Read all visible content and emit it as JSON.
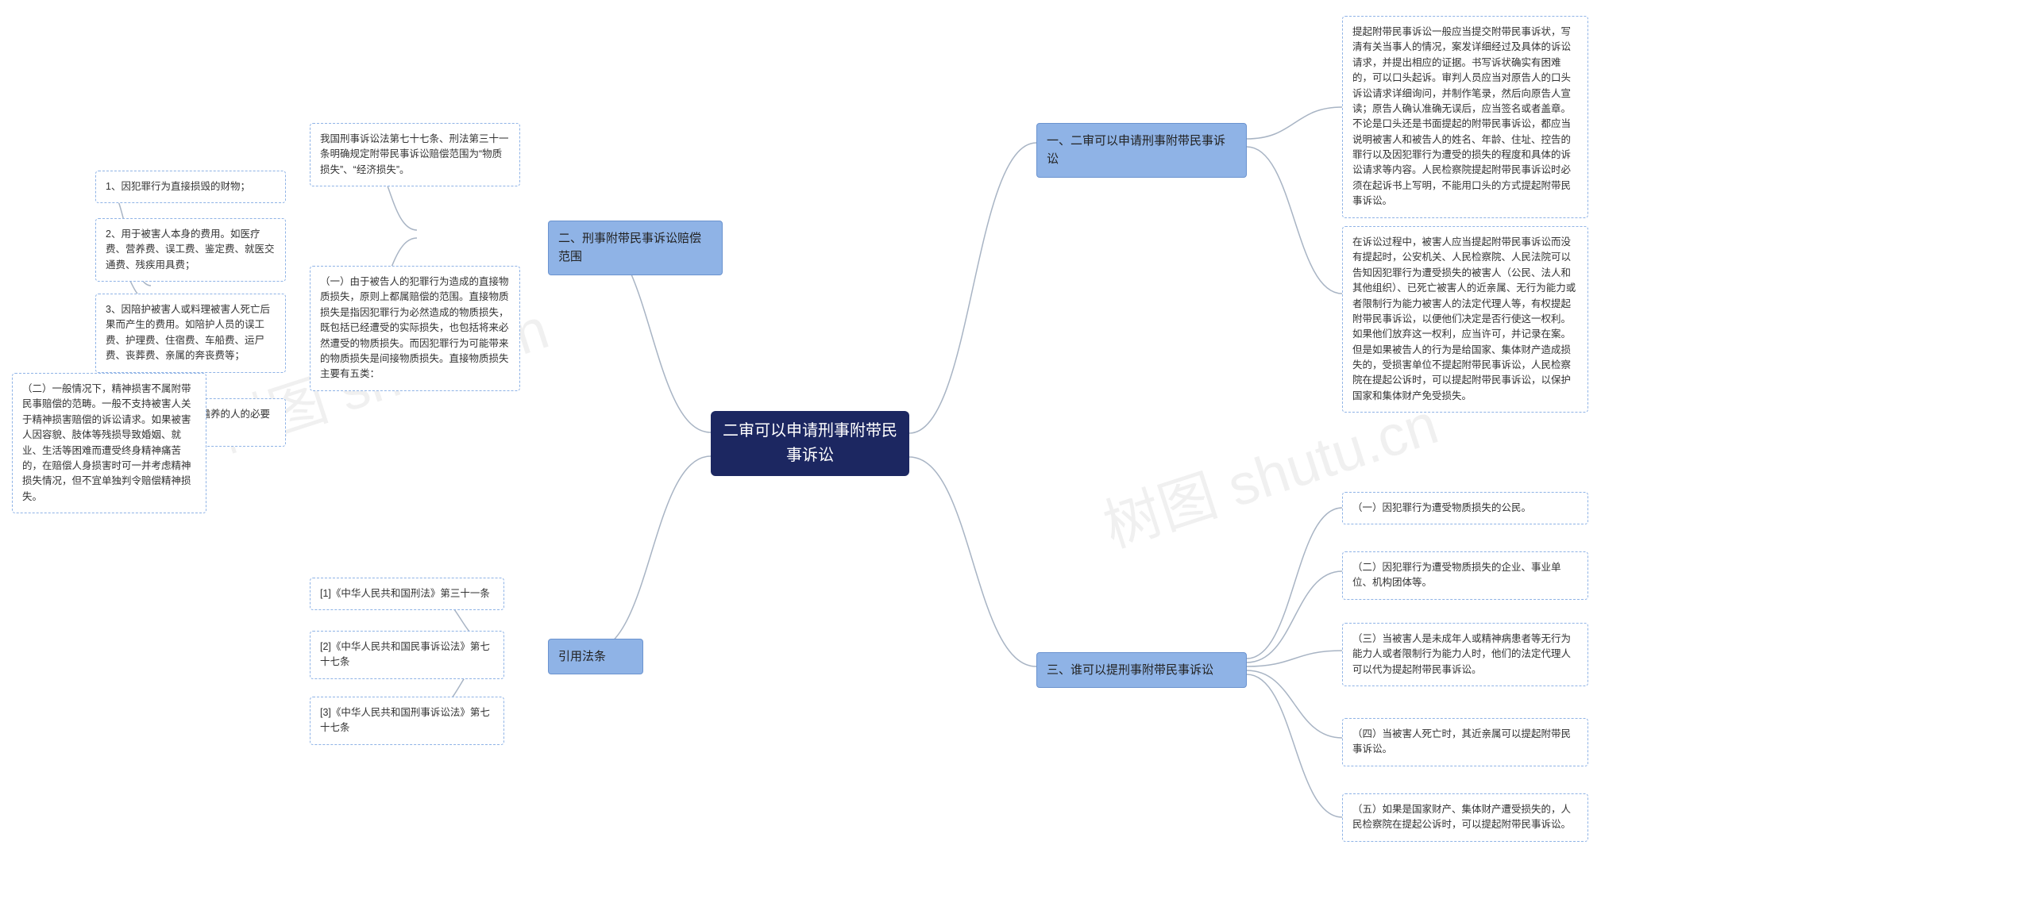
{
  "watermark": "树图 shutu.cn",
  "center": {
    "title": "二审可以申请刑事附带民事诉讼"
  },
  "right": {
    "b1": {
      "title": "一、二审可以申请刑事附带民事诉讼",
      "leaf1": "提起附带民事诉讼一般应当提交附带民事诉状，写清有关当事人的情况，案发详细经过及具体的诉讼请求，并提出相应的证据。书写诉状确实有困难的，可以口头起诉。审判人员应当对原告人的口头诉讼请求详细询问，并制作笔录，然后向原告人宣读；原告人确认准确无误后，应当签名或者盖章。不论是口头还是书面提起的附带民事诉讼，都应当说明被害人和被告人的姓名、年龄、住址、控告的罪行以及因犯罪行为遭受的损失的程度和具体的诉讼请求等内容。人民检察院提起附带民事诉讼时必须在起诉书上写明，不能用口头的方式提起附带民事诉讼。",
      "leaf2": "在诉讼过程中，被害人应当提起附带民事诉讼而没有提起时，公安机关、人民检察院、人民法院可以告知因犯罪行为遭受损失的被害人（公民、法人和其他组织）、已死亡被害人的近亲属、无行为能力或者限制行为能力被害人的法定代理人等，有权提起附带民事诉讼，以便他们决定是否行使这一权利。如果他们放弃这一权利，应当许可，并记录在案。但是如果被告人的行为是给国家、集体财产造成损失的，受损害单位不提起附带民事诉讼，人民检察院在提起公诉时，可以提起附带民事诉讼，以保护国家和集体财产免受损失。"
    },
    "b3": {
      "title": "三、谁可以提刑事附带民事诉讼",
      "leaf1": "（一）因犯罪行为遭受物质损失的公民。",
      "leaf2": "（二）因犯罪行为遭受物质损失的企业、事业单位、机构团体等。",
      "leaf3": "（三）当被害人是未成年人或精神病患者等无行为能力人或者限制行为能力人时，他们的法定代理人可以代为提起附带民事诉讼。",
      "leaf4": "（四）当被害人死亡时，其近亲属可以提起附带民事诉讼。",
      "leaf5": "（五）如果是国家财产、集体财产遭受损失的，人民检察院在提起公诉时，可以提起附带民事诉讼。"
    }
  },
  "left": {
    "b2": {
      "title": "二、刑事附带民事诉讼赔偿范围",
      "intro": "我国刑事诉讼法第七十七条、刑法第三十一条明确规定附带民事诉讼赔偿范围为“物质损失”、“经济损失”。",
      "subA": "（一）由于被告人的犯罪行为造成的直接物质损失，原则上都属赔偿的范围。直接物质损失是指因犯罪行为必然造成的物质损失，既包括已经遭受的实际损失，也包括将来必然遭受的物质损失。而因犯罪行为可能带来的物质损失是间接物质损失。直接物质损失主要有五类：",
      "subA_items": {
        "i1": "1、因犯罪行为直接损毁的财物；",
        "i2": "2、用于被害人本身的费用。如医疗费、营养费、误工费、鉴定费、就医交通费、残疾用具费；",
        "i3": "3、因陪护被害人或料理被害人死亡后果而产生的费用。如陪护人员的误工费、护理费、住宿费、车船费、运尸费、丧葬费、亲属的奔丧费等；",
        "i4": "4、原由被害人抚养和赡养的人的必要生活补助。"
      },
      "subB": "（二）一般情况下，精神损害不属附带民事赔偿的范畴。一般不支持被害人关于精神损害赔偿的诉讼请求。如果被害人因容貌、肢体等残损导致婚姻、就业、生活等困难而遭受终身精神痛苦的，在赔偿人身损害时可一并考虑精神损失情况，但不宜单独判令赔偿精神损失。"
    },
    "law": {
      "title": "引用法条",
      "items": {
        "l1": "[1]《中华人民共和国刑法》第三十一条",
        "l2": "[2]《中华人民共和国民事诉讼法》第七十七条",
        "l3": "[3]《中华人民共和国刑事诉讼法》第七十七条"
      }
    }
  }
}
